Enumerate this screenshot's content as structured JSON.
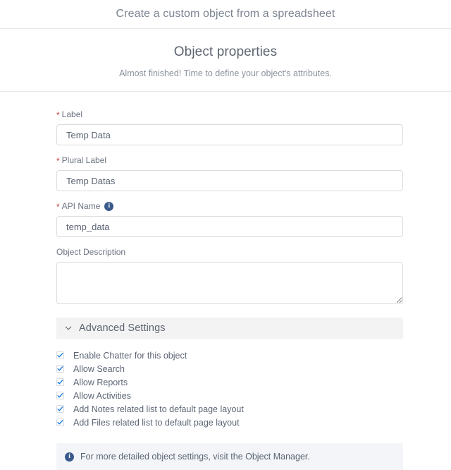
{
  "topbar": {
    "title": "Create a custom object from a spreadsheet"
  },
  "section": {
    "title": "Object properties",
    "subtitle": "Almost finished! Time to define your object's attributes."
  },
  "fields": {
    "label": {
      "label": "Label",
      "required_marker": "*",
      "value": "Temp Data",
      "placeholder": ""
    },
    "plural_label": {
      "label": "Plural Label",
      "required_marker": "*",
      "value": "Temp Datas",
      "placeholder": ""
    },
    "api_name": {
      "label": "API Name",
      "required_marker": "*",
      "value": "temp_data",
      "placeholder": "",
      "info_icon": "info-icon",
      "info_glyph": "i"
    },
    "object_description": {
      "label": "Object Description",
      "value": "",
      "placeholder": ""
    }
  },
  "advanced_settings": {
    "title": "Advanced Settings",
    "chevron_icon": "chevron-down-icon",
    "expanded": true,
    "options": [
      {
        "label": "Enable Chatter for this object",
        "checked": true
      },
      {
        "label": "Allow Search",
        "checked": true
      },
      {
        "label": "Allow Reports",
        "checked": true
      },
      {
        "label": "Allow Activities",
        "checked": true
      },
      {
        "label": "Add Notes related list to default page layout",
        "checked": true
      },
      {
        "label": "Add Files related list to default page layout",
        "checked": true
      }
    ]
  },
  "note": {
    "icon": "info-icon",
    "icon_glyph": "i",
    "text": "For more detailed object settings, visit the Object Manager."
  },
  "colors": {
    "required_star": "#c23934",
    "info_icon_bg": "#3b5a8c",
    "checkbox_check": "#1b7ee0",
    "note_bg": "#f3f5f8",
    "advanced_header_bg": "#f3f3f3",
    "divider": "#e4e6e9",
    "text_primary": "#5b6473",
    "text_muted": "#8a919c"
  }
}
